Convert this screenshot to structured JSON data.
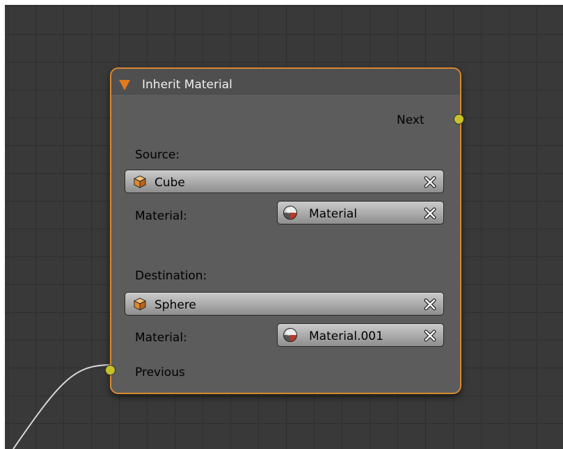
{
  "node": {
    "title": "Inherit Material",
    "outputs": {
      "next": "Next"
    },
    "inputs": {
      "previous": "Previous"
    },
    "source": {
      "heading": "Source:",
      "object": "Cube",
      "material_label": "Material:",
      "material": "Material"
    },
    "destination": {
      "heading": "Destination:",
      "object": "Sphere",
      "material_label": "Material:",
      "material": "Material.001"
    }
  },
  "colors": {
    "node_border": "#d88a2e",
    "socket": "#c7c229",
    "collapse_arrow": "#e27a1e"
  },
  "icons": {
    "object": "cube-icon",
    "material": "material-sphere-icon",
    "clear": "clear-x-icon",
    "collapse": "collapse-triangle-icon"
  }
}
